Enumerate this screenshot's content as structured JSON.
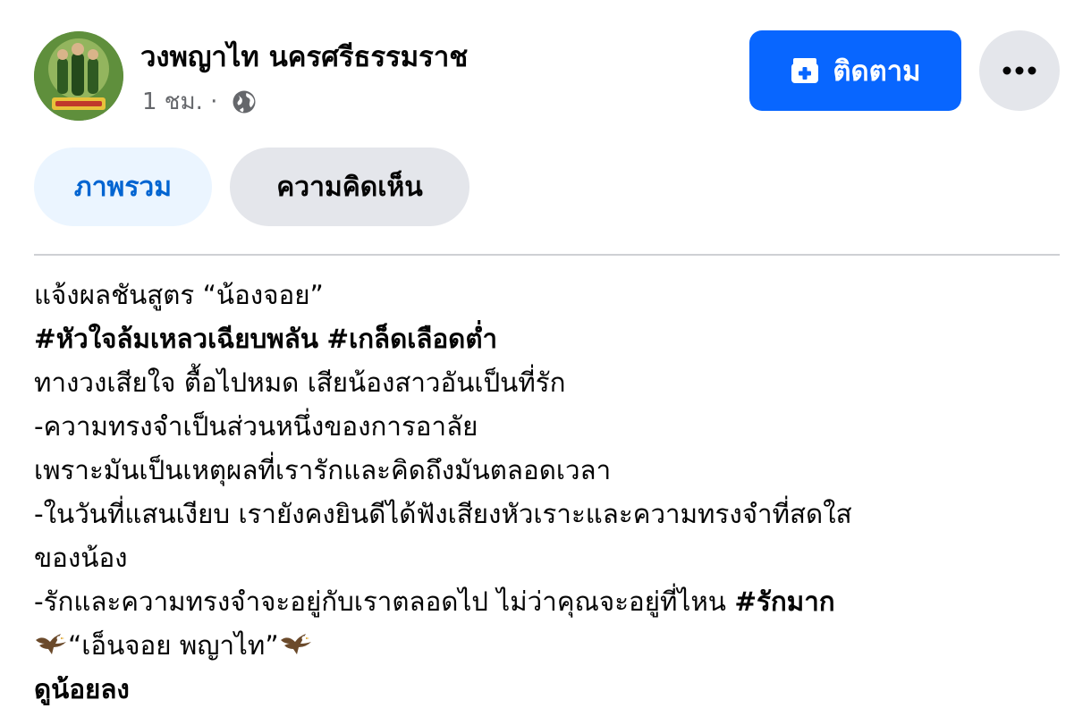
{
  "post": {
    "page_name": "วงพญาไท นครศรีธรรมราช",
    "time": "1 ชม.",
    "separator": "·",
    "privacy_icon": "globe-icon"
  },
  "actions": {
    "follow_label": "ติดตาม",
    "follow_icon": "follow-add-icon",
    "more_icon": "more-dots-icon"
  },
  "tabs": [
    {
      "label": "ภาพรวม",
      "active": true
    },
    {
      "label": "ความคิดเห็น",
      "active": false
    }
  ],
  "body": {
    "line1": "แจ้งผลชันสูตร “น้องจอย”",
    "line2_hashtag1": "#หัวใจล้มเหลวเฉียบพลัน",
    "line2_hashtag2": "#เกล็ดเลือดต่ำ",
    "line3": "ทางวงเสียใจ ตื้อไปหมด เสียน้องสาวอันเป็นที่รัก",
    "line4": "-ความทรงจำเป็นส่วนหนึ่งของการอาลัย",
    "line5": "เพราะมันเป็นเหตุผลที่เรารักและคิดถึงมันตลอดเวลา",
    "line6": "-ในวันที่แสนเงียบ เรายังคงยินดีได้ฟังเสียงหัวเราะและความทรงจำที่สดใส",
    "line7": "ของน้อง",
    "line8_text": "-รักและความทรงจำจะอยู่กับเราตลอดไป ไม่ว่าคุณจะอยู่ที่ไหน",
    "line8_hashtag": "#รักมาก",
    "line9_text": "“เอ็นจอย พญาไท”",
    "emoji_icon": "eagle-icon",
    "see_less": "ดูน้อยลง"
  },
  "colors": {
    "primary_blue": "#0866ff",
    "tab_active_bg": "#ebf5ff",
    "tab_active_text": "#0064d1",
    "secondary_bg": "#e4e6eb",
    "meta_text": "#65676b"
  }
}
